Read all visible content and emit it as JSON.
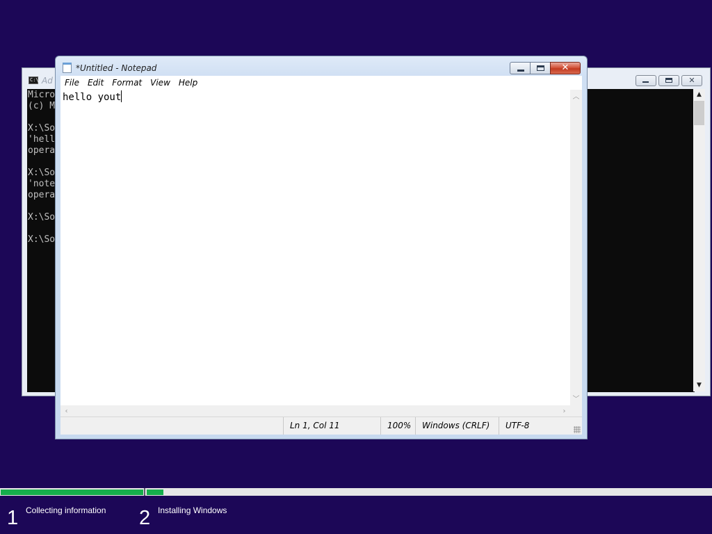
{
  "console_window": {
    "title": "Ad",
    "icon": "cmd-icon",
    "lines": [
      "Micro",
      "(c) M",
      "",
      "X:\\So",
      "'hell",
      "opera",
      "",
      "X:\\So",
      "'note",
      "opera",
      "",
      "X:\\So",
      "",
      "X:\\So"
    ]
  },
  "notepad": {
    "title": "*Untitled - Notepad",
    "menu": [
      "File",
      "Edit",
      "Format",
      "View",
      "Help"
    ],
    "text": "hello yout",
    "status": {
      "position": "Ln 1, Col 11",
      "zoom": "100%",
      "line_ending": "Windows (CRLF)",
      "encoding": "UTF-8"
    }
  },
  "setup": {
    "steps": [
      {
        "number": "1",
        "label": "Collecting information"
      },
      {
        "number": "2",
        "label": "Installing Windows"
      }
    ],
    "step1_progress": 1.0,
    "step2_progress": 0.03
  },
  "colors": {
    "desktop": "#1c0757",
    "progress": "#16ae4c",
    "console_bg": "#0c0c0c"
  }
}
